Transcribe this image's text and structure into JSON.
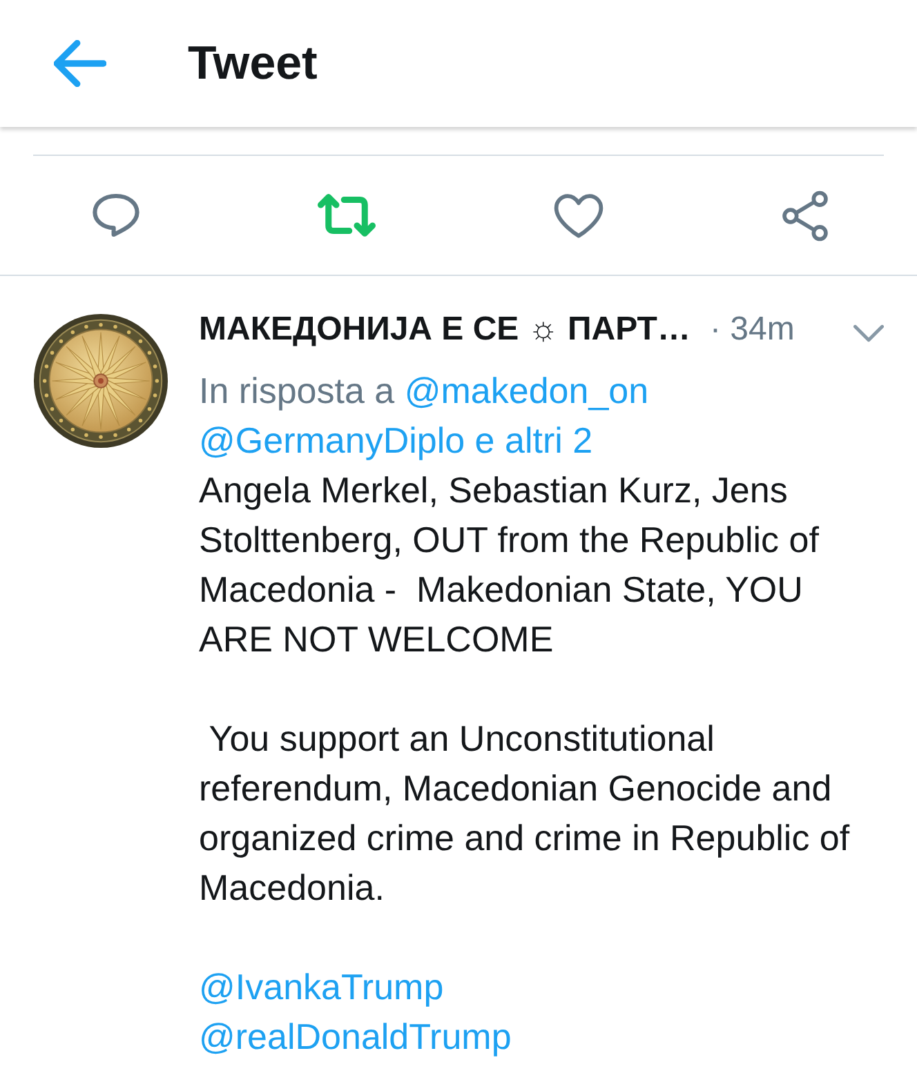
{
  "header": {
    "title": "Tweet"
  },
  "actions": [
    {
      "kind": "reply"
    },
    {
      "kind": "retweet",
      "active": true
    },
    {
      "kind": "like",
      "active": false
    },
    {
      "kind": "share"
    }
  ],
  "tweet": {
    "author": "МАКЕДОНИЈА Е СЕ ☼ ПАРТ…",
    "time": "· 34m",
    "reply_to": {
      "prefix": "In risposta a",
      "links": [
        "@makedon_on",
        "@GermanyDiplo",
        "e altri 2"
      ]
    },
    "paragraphs": [
      "Angela Merkel, Sebastian Kurz, Jens Stolttenberg, OUT from the Republic of Macedonia -  Makedonian State, YOU ARE NOT WELCOME",
      " You support an Unconstitutional referendum, Macedonian Genocide and organized crime and crime in Republic of Macedonia."
    ],
    "mentions": [
      "@IvankaTrump",
      "@realDonaldTrump"
    ]
  }
}
